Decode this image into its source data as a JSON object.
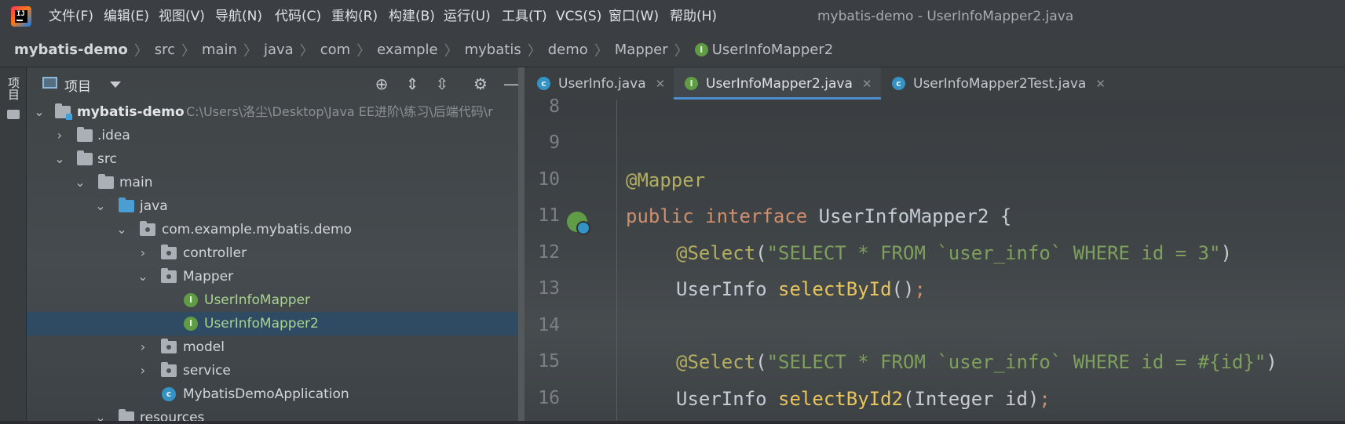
{
  "menubar": {
    "items": [
      "文件(F)",
      "编辑(E)",
      "视图(V)",
      "导航(N)",
      "代码(C)",
      "重构(R)",
      "构建(B)",
      "运行(U)",
      "工具(T)",
      "VCS(S)",
      "窗口(W)",
      "帮助(H)"
    ],
    "window_title": "mybatis-demo - UserInfoMapper2.java",
    "logo_text": "IJ"
  },
  "breadcrumb": [
    "mybatis-demo",
    "src",
    "main",
    "java",
    "com",
    "example",
    "mybatis",
    "demo",
    "Mapper",
    "UserInfoMapper2"
  ],
  "left_stripe": {
    "project_label": "项目"
  },
  "project_panel": {
    "title": "项目",
    "tree": [
      {
        "label": "mybatis-demo",
        "path": "C:\\Users\\洛尘\\Desktop\\Java EE进阶\\练习\\后端代码\\r",
        "icon": "module-folder-icon",
        "expanded": true
      },
      {
        "label": ".idea",
        "icon": "folder-icon",
        "expanded": false
      },
      {
        "label": "src",
        "icon": "folder-icon",
        "expanded": true
      },
      {
        "label": "main",
        "icon": "folder-icon",
        "expanded": true
      },
      {
        "label": "java",
        "icon": "source-folder-icon",
        "expanded": true
      },
      {
        "label": "com.example.mybatis.demo",
        "icon": "package-icon",
        "expanded": true
      },
      {
        "label": "controller",
        "icon": "package-icon",
        "expanded": false
      },
      {
        "label": "Mapper",
        "icon": "package-icon",
        "expanded": true
      },
      {
        "label": "UserInfoMapper",
        "icon": "interface-icon"
      },
      {
        "label": "UserInfoMapper2",
        "icon": "interface-icon",
        "selected": true
      },
      {
        "label": "model",
        "icon": "package-icon",
        "expanded": false
      },
      {
        "label": "service",
        "icon": "package-icon",
        "expanded": false
      },
      {
        "label": "MybatisDemoApplication",
        "icon": "spring-class-icon"
      },
      {
        "label": "resources",
        "icon": "folder-icon",
        "expanded": true
      }
    ]
  },
  "tabs": [
    {
      "label": "UserInfo.java",
      "icon": "class-icon",
      "icon_letter": "c",
      "active": false
    },
    {
      "label": "UserInfoMapper2.java",
      "icon": "interface-icon",
      "icon_letter": "I",
      "active": true
    },
    {
      "label": "UserInfoMapper2Test.java",
      "icon": "class-icon",
      "icon_letter": "c",
      "active": false
    }
  ],
  "editor": {
    "line_numbers": [
      "8",
      "9",
      "10",
      "11",
      "12",
      "13",
      "14",
      "15",
      "16"
    ],
    "line10": {
      "anno": "@Mapper"
    },
    "line11": {
      "kw1": "public",
      "kw2": "interface",
      "name": "UserInfoMapper2",
      "brace": " {"
    },
    "line12": {
      "anno": "@Select",
      "open": "(",
      "str": "\"SELECT * FROM `user_info` WHERE id = 3\"",
      "close": ")"
    },
    "line13": {
      "type": "UserInfo ",
      "method": "selectById",
      "parens": "()",
      "semi": ";"
    },
    "line15": {
      "anno": "@Select",
      "open": "(",
      "str": "\"SELECT * FROM `user_info` WHERE id = #{id}\"",
      "close": ")"
    },
    "line16": {
      "type": "UserInfo ",
      "method": "selectById2",
      "params": "(Integer id)",
      "semi": ";"
    }
  },
  "colors": {
    "accent": "#4b8fd1",
    "interface_icon": "#5f9c45",
    "class_icon": "#3592c4",
    "selected_row": "#2f4b63"
  }
}
